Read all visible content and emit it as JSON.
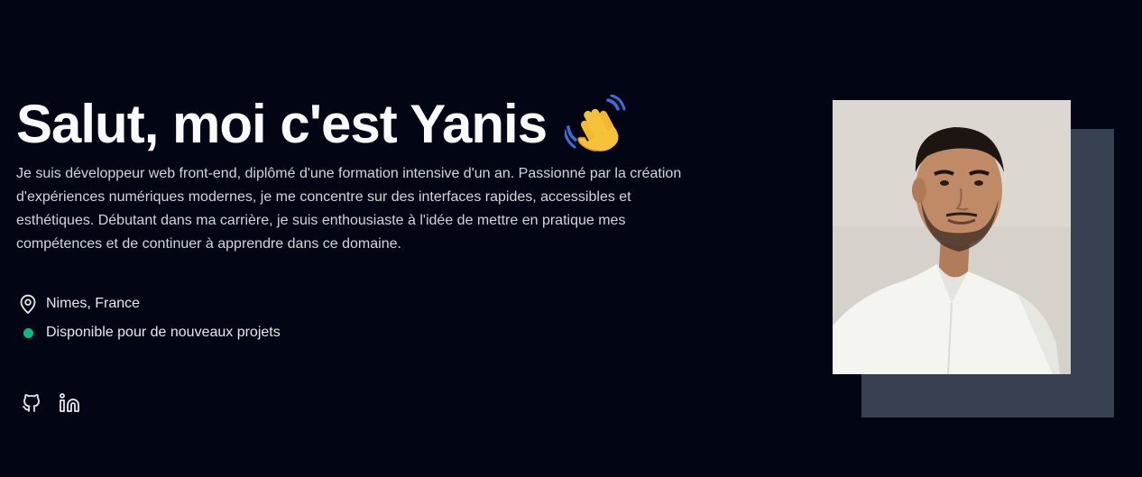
{
  "hero": {
    "title": "Salut, moi c'est Yanis",
    "emoji_icon": "waving-hand-icon",
    "intro": "Je suis développeur web front-end, diplômé d'une formation intensive d'un an. Passionné par la création d'expériences numériques modernes, je me concentre sur des interfaces rapides, accessibles et esthétiques. Débutant dans ma carrière, je suis enthousiaste à l'idée de mettre en pratique mes compétences et de continuer à apprendre dans ce domaine.",
    "location": "Nimes, France",
    "location_icon": "map-pin-icon",
    "status": "Disponible pour de nouveaux projets",
    "status_color": "#10b981",
    "socials": [
      {
        "name": "GitHub",
        "icon": "github-icon"
      },
      {
        "name": "LinkedIn",
        "icon": "linkedin-icon"
      }
    ]
  },
  "colors": {
    "background": "#020614",
    "text": "#f8fafc",
    "muted_text": "#d1d5db",
    "photo_frame": "#374151"
  }
}
